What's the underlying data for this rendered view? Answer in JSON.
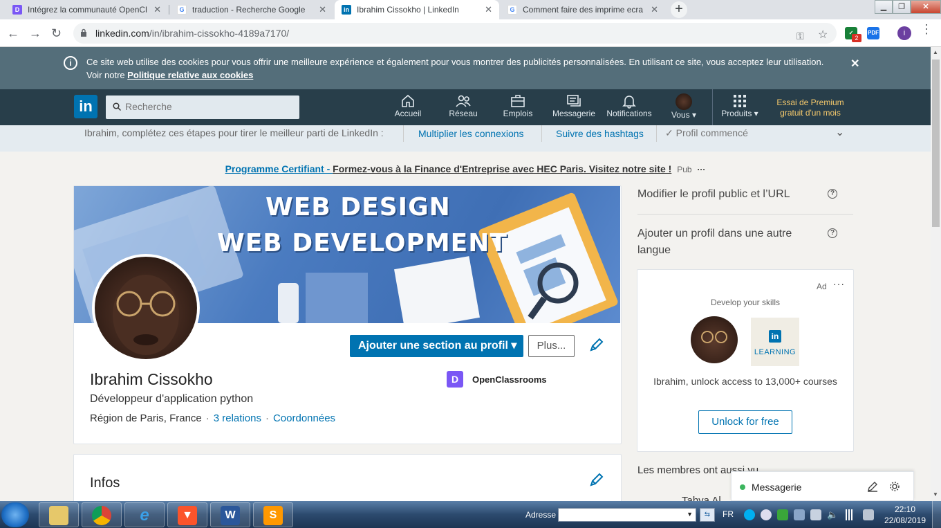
{
  "browser": {
    "tabs": [
      {
        "title": "Intégrez la communauté OpenCl",
        "favicon": "openclassrooms-icon",
        "active": false
      },
      {
        "title": "traduction - Recherche Google",
        "favicon": "google-icon",
        "active": false
      },
      {
        "title": "Ibrahim Cissokho | LinkedIn",
        "favicon": "linkedin-icon",
        "active": true
      },
      {
        "title": "Comment faire des imprime ecra",
        "favicon": "google-icon",
        "active": false
      }
    ],
    "new_tab": "+",
    "url_host": "linkedin.com",
    "url_path": "/in/ibrahim-cissokho-4189a7170/",
    "ext_badge": "2",
    "ext_pdf": "PDF",
    "profile_initial": "i"
  },
  "cookie_banner": {
    "text": "Ce site web utilise des cookies pour vous offrir une meilleure expérience et également pour vous montrer des publicités personnalisées. En utilisant ce site, vous acceptez leur utilisation. Voir notre ",
    "link": "Politique relative aux cookies",
    "close": "✕"
  },
  "linkedin_nav": {
    "logo": "in",
    "search_placeholder": "Recherche",
    "items": [
      {
        "label": "Accueil",
        "icon": "home-icon"
      },
      {
        "label": "Réseau",
        "icon": "network-icon"
      },
      {
        "label": "Emplois",
        "icon": "jobs-icon"
      },
      {
        "label": "Messagerie",
        "icon": "messaging-icon"
      },
      {
        "label": "Notifications",
        "icon": "bell-icon"
      },
      {
        "label": "Vous ▾",
        "icon": "me-avatar"
      },
      {
        "label": "Produits ▾",
        "icon": "grid-icon"
      }
    ],
    "premium": "Essai de Premium gratuit d'un mois"
  },
  "progress": {
    "intro": "Ibrahim, complétez ces étapes pour tirer le meilleur parti de LinkedIn :",
    "steps": [
      "Multiplier les connexions",
      "Suivre des hashtags"
    ],
    "done": "Profil commencé"
  },
  "ad_line": {
    "link": "Programme Certifiant - ",
    "rest": "Formez-vous à la Finance d'Entreprise avec HEC Paris. Visitez notre site !",
    "pub": "Pub",
    "more": "···"
  },
  "profile": {
    "banner_line1": "WEB DESIGN",
    "banner_line2": "WEB DEVELOPMENT",
    "add_section": "Ajouter une section au profil",
    "more": "Plus...",
    "name": "Ibrahim Cissokho",
    "headline": "Développeur d'application python",
    "location": "Région de Paris, France",
    "relations": "3 relations",
    "contact": "Coordonnées",
    "school": "OpenClassrooms"
  },
  "infos": {
    "title": "Infos"
  },
  "sidebar": {
    "public_profile": "Modifier le profil public et l’URL",
    "add_language": "Ajouter un profil dans une autre langue",
    "ad": {
      "label": "Ad",
      "dots": "···",
      "develop": "Develop your skills",
      "learning": "LEARNING",
      "unlock": "Ibrahim, unlock access to 13,000+ courses",
      "cta": "Unlock for free"
    },
    "also_viewed": "Les membres ont aussi vu",
    "ghost_name": "Tahya Al..."
  },
  "messaging": {
    "label": "Messagerie"
  },
  "taskbar": {
    "address_label": "Adresse",
    "lang": "FR",
    "time": "22:10",
    "date": "22/08/2019"
  },
  "colors": {
    "linkedin_blue": "#0073b1",
    "nav_dark": "#283e4a",
    "cookie_bg": "#546e7a",
    "premium_gold": "#f5c96c"
  }
}
